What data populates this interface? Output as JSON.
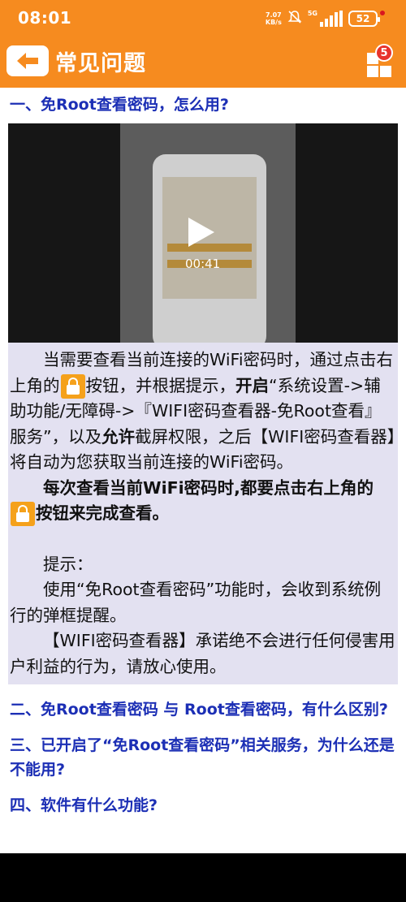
{
  "status": {
    "time": "08:01",
    "net_speed_value": "7.07",
    "net_speed_unit": "KB/s",
    "network": "5G",
    "battery": "52",
    "icons": [
      "mute-bell-icon",
      "signal-icon",
      "battery-icon"
    ]
  },
  "appbar": {
    "title": "常见问题",
    "back_icon": "arrow-left-icon",
    "menu_icon": "grid-menu-icon",
    "menu_badge": "5",
    "color": "#f68b1f"
  },
  "faq": {
    "q1": "一、免Root查看密码，怎么用?",
    "video": {
      "duration": "00:41",
      "play_icon": "play-icon"
    },
    "answer": {
      "p1_before_icon": "当需要查看当前连接的WiFi密码时，通过点击右上角的",
      "p1_after_icon": "按钮，并根据提示，",
      "p1_bold_open": "开启",
      "p1_mid": "“系统设置->辅助功能/无障碍->『WIFI密码查看器-免Root查看』服务”，以及",
      "p1_bold_allow": "允许",
      "p1_end": "截屏权限，之后【WIFI密码查看器】将自动为您获取当前连接的WiFi密码。",
      "p2_before_icon": "每次查看当前WiFi密码时,都要点击右上角的",
      "p2_after_icon": "按钮来完成查看。",
      "tip_label": "提示：",
      "tip1": "使用“免Root查看密码”功能时，会收到系统例行的弹框提醒。",
      "tip2": "【WIFI密码查看器】承诺绝不会进行任何侵害用户利益的行为，请放心使用。"
    },
    "q2": "二、免Root查看密码 与 Root查看密码，有什么区别?",
    "q3": "三、已开启了“免Root查看密码”相关服务，为什么还是不能用?",
    "q4": "四、软件有什么功能?"
  }
}
